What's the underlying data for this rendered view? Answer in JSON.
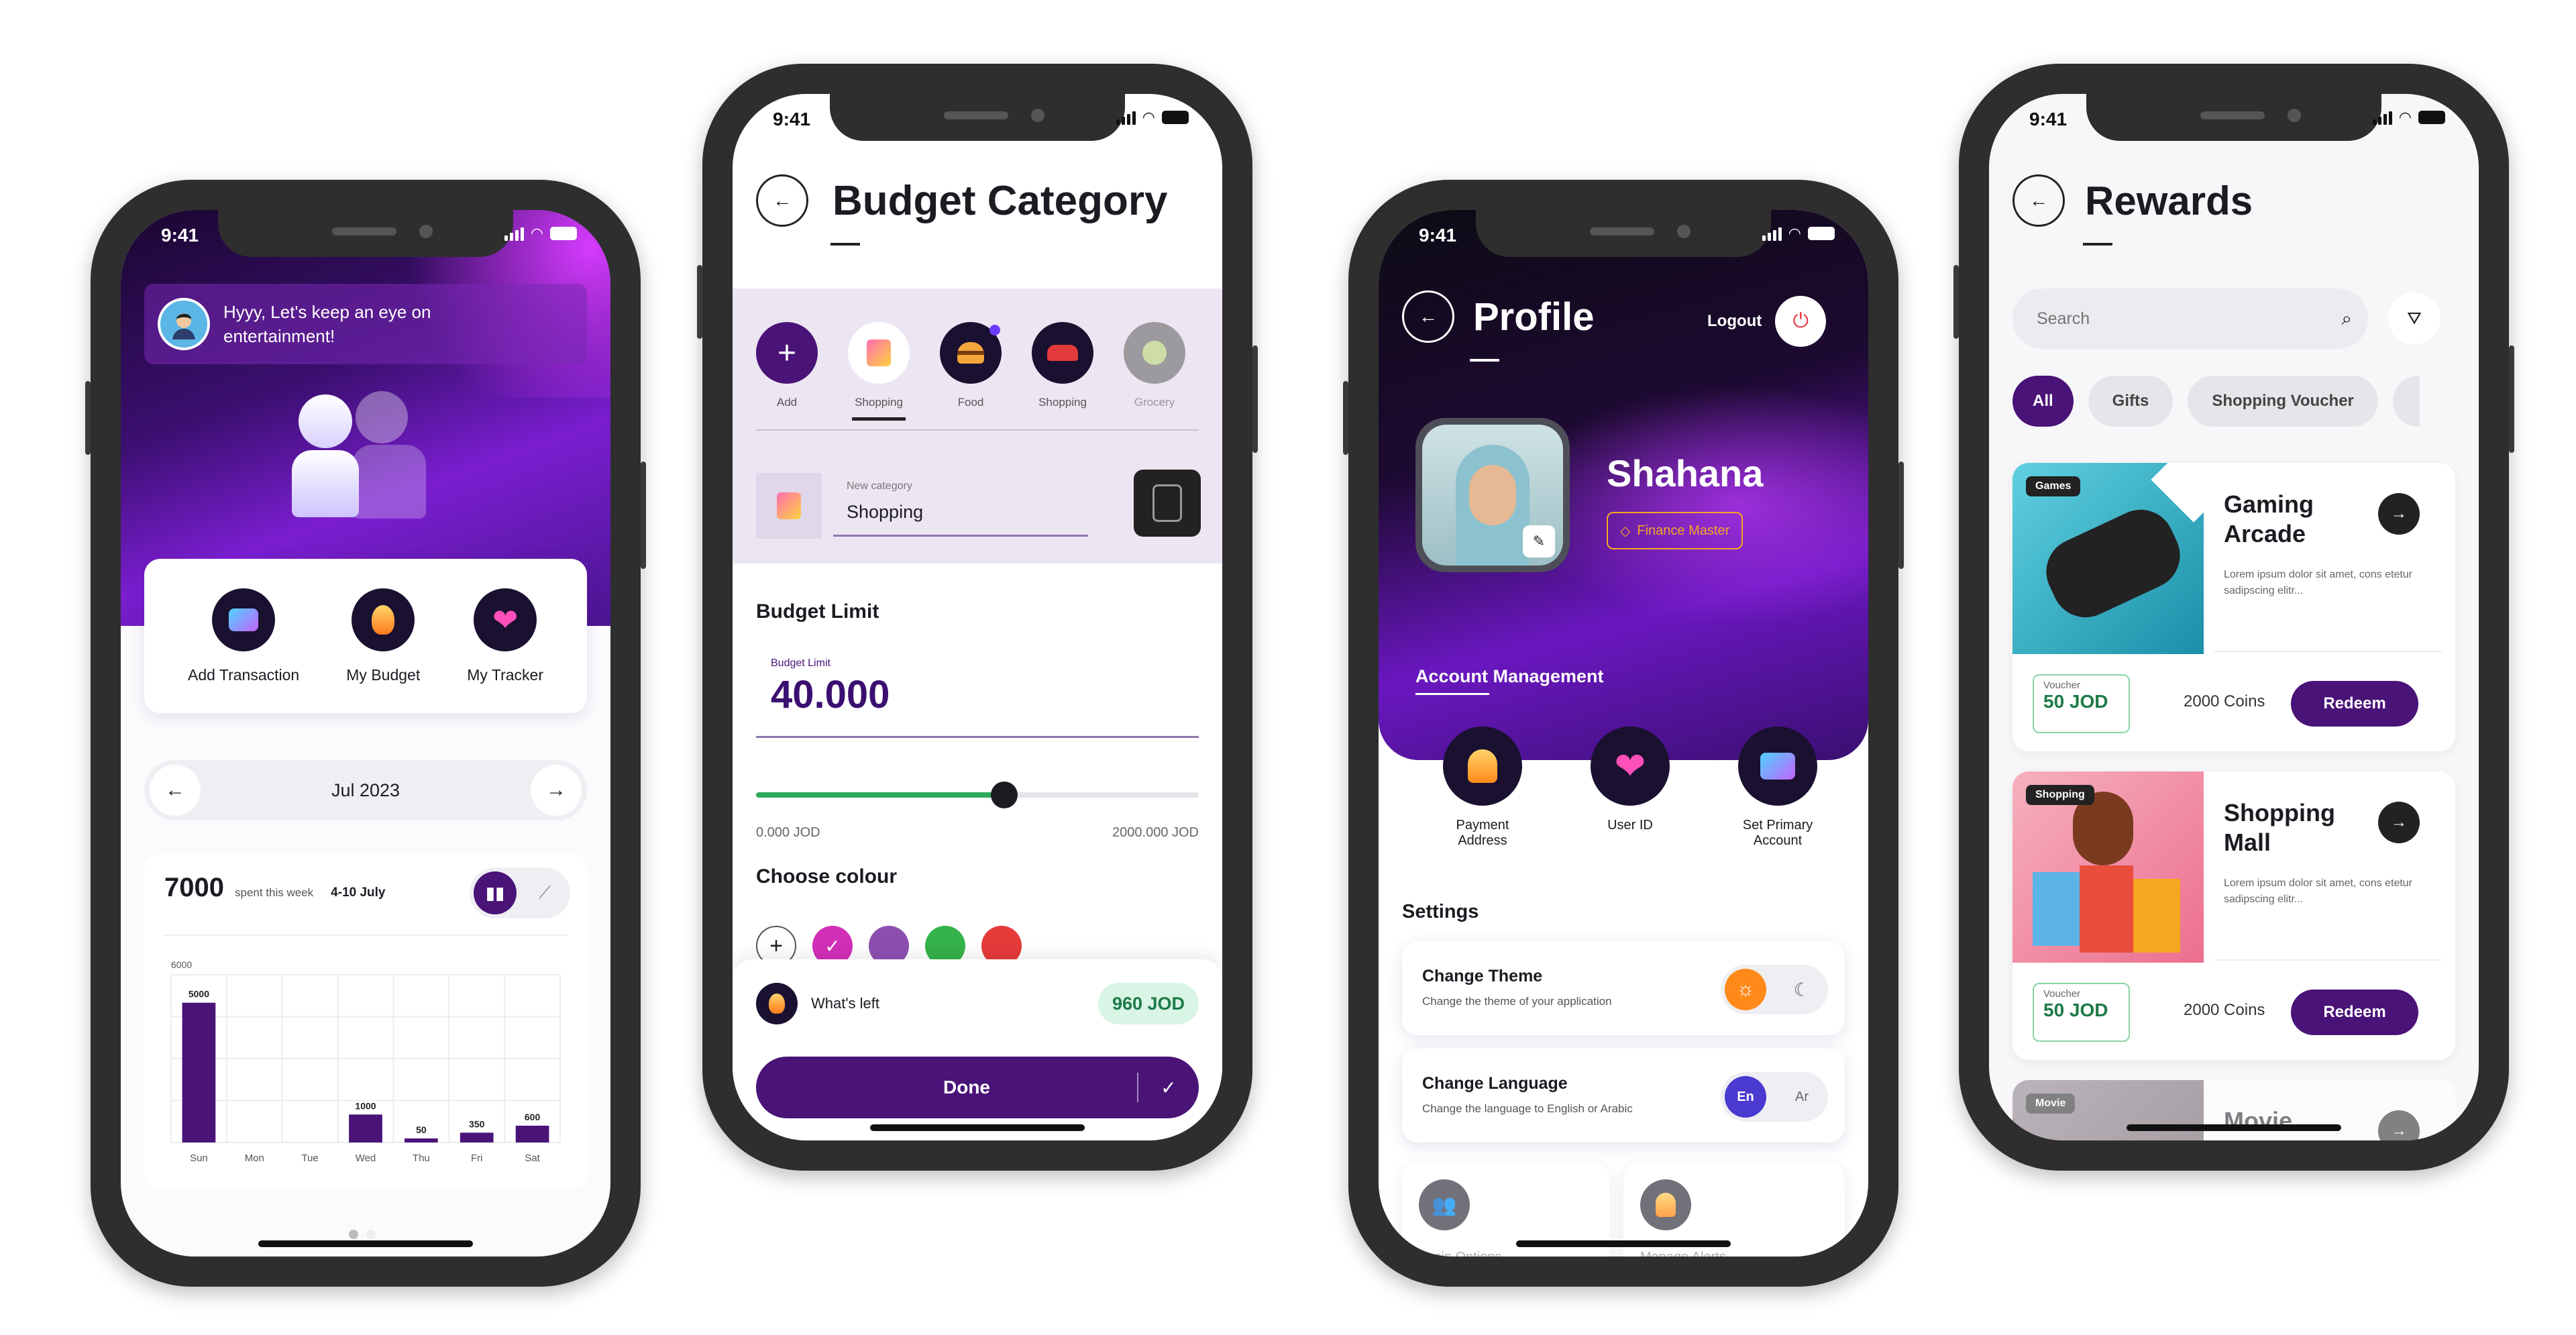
{
  "status": {
    "time": "9:41"
  },
  "home": {
    "greeting": "Hyyy, Let's keep an eye on entertainment!",
    "actions": [
      {
        "label": "Add Transaction",
        "icon": "wallet-icon"
      },
      {
        "label": "My Budget",
        "icon": "flame-icon"
      },
      {
        "label": "My Tracker",
        "icon": "heart-icon"
      }
    ],
    "month": "Jul 2023",
    "amount": "7000",
    "spent_text": "spent this week",
    "range": "4-10 July",
    "chart_data": {
      "type": "bar",
      "categories": [
        "Sun",
        "Mon",
        "Tue",
        "Wed",
        "Thu",
        "Fri",
        "Sat"
      ],
      "values": [
        5000,
        0,
        0,
        1000,
        50,
        350,
        600
      ],
      "data_labels": [
        "5000",
        "",
        "",
        "1000",
        "50",
        "350",
        "600"
      ],
      "ytick": "6000",
      "ylim": [
        0,
        6000
      ],
      "color": "#4a1378"
    }
  },
  "budget": {
    "title": "Budget Category",
    "categories": [
      {
        "label": "Add",
        "icon": "plus-icon"
      },
      {
        "label": "Shopping",
        "icon": "shopping-bag-icon"
      },
      {
        "label": "Food",
        "icon": "burger-icon"
      },
      {
        "label": "Shopping",
        "icon": "car-icon"
      },
      {
        "label": "Grocery",
        "icon": "grocery-icon"
      }
    ],
    "new_category_label": "New category",
    "new_category_value": "Shopping",
    "limit_heading": "Budget Limit",
    "limit_label": "Budget Limit",
    "limit_value": "40.000",
    "slider_min": "0.000 JOD",
    "slider_max": "2000.000 JOD",
    "slider_fraction": 0.56,
    "colour_heading": "Choose colour",
    "colours": [
      "#d12fb8",
      "#8c4fb0",
      "#35b34a",
      "#e63a3a"
    ],
    "whats_left_label": "What's left",
    "whats_left_value": "960 JOD",
    "done_label": "Done"
  },
  "profile": {
    "title": "Profile",
    "logout": "Logout",
    "name": "Shahana",
    "badge": "Finance Master",
    "account_heading": "Account Management",
    "account_items": [
      {
        "label": "Payment Address",
        "icon": "home-icon"
      },
      {
        "label": "User ID",
        "icon": "heart-icon"
      },
      {
        "label": "Set Primary Account",
        "icon": "wallet-icon"
      }
    ],
    "settings_heading": "Settings",
    "theme_title": "Change Theme",
    "theme_sub": "Change the theme of your application",
    "language_title": "Change Language",
    "language_sub": "Change the language to English or Arabic",
    "lang_en": "En",
    "lang_ar": "Ar",
    "tiles": [
      "Login Options",
      "Manage Alerts"
    ]
  },
  "rewards": {
    "title": "Rewards",
    "search_placeholder": "Search",
    "filters": [
      "All",
      "Gifts",
      "Shopping Voucher"
    ],
    "items": [
      {
        "tag": "Games",
        "title": "Gaming Arcade",
        "desc": "Lorem ipsum dolor sit amet, cons etetur sadipscing elitr...",
        "voucher_label": "Voucher",
        "voucher_value": "50 JOD",
        "coins": "2000 Coins",
        "cta": "Redeem"
      },
      {
        "tag": "Shopping",
        "title": "Shopping Mall",
        "desc": "Lorem ipsum dolor sit amet, cons etetur sadipscing elitr...",
        "voucher_label": "Voucher",
        "voucher_value": "50 JOD",
        "coins": "2000 Coins",
        "cta": "Redeem"
      },
      {
        "tag": "Movie",
        "title": "Movie"
      }
    ]
  }
}
